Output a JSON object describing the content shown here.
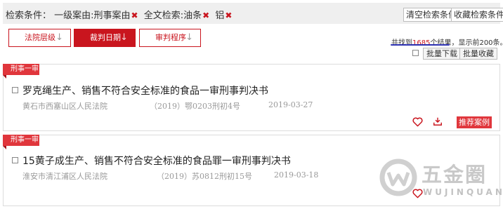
{
  "search_conditions": {
    "label": "检索条件：",
    "items": [
      {
        "text": "一级案由:刑事案由",
        "remove": "✖"
      },
      {
        "text": "全文检索:油条",
        "remove": "✖"
      },
      {
        "text": "铝",
        "remove": "✖"
      }
    ],
    "clear_button": "清空检索条件",
    "save_button": "收藏检索条件"
  },
  "sort_tabs": [
    {
      "label": "法院层级",
      "arrow": "↓"
    },
    {
      "label": "裁判日期",
      "arrow": "↓"
    },
    {
      "label": "审判程序",
      "arrow": "↓"
    }
  ],
  "result_summary": {
    "prefix": "共找到",
    "count": "1685",
    "suffix": "个结果，显示前200条。"
  },
  "batch_actions": {
    "download": "批量下载",
    "collect": "批量收藏"
  },
  "cases": [
    {
      "tag": "刑事一审",
      "title": "罗克绳生产、销售不符合安全标准的食品一审刑事判决书",
      "court": "黄石市西塞山区人民法院",
      "case_no": "（2019）鄂0203刑初4号",
      "date": "2019-03-27",
      "recommend": "推荐案例"
    },
    {
      "tag": "刑事一审",
      "title": "15黄子成生产、销售不符合安全标准的食品罪一审刑事判决书",
      "court": "淮安市清江浦区人民法院",
      "case_no": "（2019）苏0812刑初15号",
      "date": "2019-03-18"
    }
  ],
  "watermark": {
    "name": "五金圈",
    "pinyin": "WUJINQUAN"
  },
  "colors": {
    "accent": "#c9151e",
    "tag": "#e0363c",
    "muted_text": "#999999",
    "underline": "#2b2fb0"
  }
}
